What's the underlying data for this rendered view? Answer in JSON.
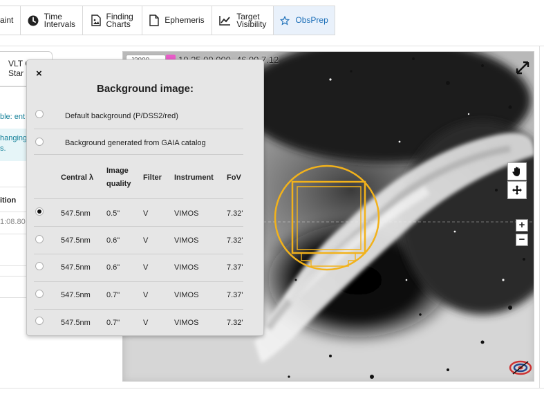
{
  "tabs": [
    {
      "label": "aint",
      "icon": "none",
      "active": false
    },
    {
      "label": "Time\nIntervals",
      "icon": "clock-icon",
      "active": false
    },
    {
      "label": "Finding\nCharts",
      "icon": "image-file-icon",
      "active": false
    },
    {
      "label": "Ephemeris",
      "icon": "file-icon",
      "active": false
    },
    {
      "label": "Target\nVisibility",
      "icon": "line-chart-icon",
      "active": false
    },
    {
      "label": "ObsPrep",
      "icon": "star-icon",
      "active": true
    }
  ],
  "left_pane": {
    "chip_label": "VLT C\nStar",
    "hint_line1": "ble: ent",
    "hint_line2": "hanging\ns.",
    "position_label": "ition",
    "position_value": "1:08.80"
  },
  "aladin": {
    "coord_input": "J2000",
    "coordinates": "10 25 00.000 -46 00 7.12",
    "zoom_in": "+",
    "zoom_out": "−",
    "accent_color": "#f2b21b"
  },
  "bg_popup": {
    "close_label": "×",
    "title": "Background image:",
    "options": [
      {
        "label": "Default background (P/DSS2/red)",
        "checked": false
      },
      {
        "label": "Background generated from GAIA catalog",
        "checked": false
      }
    ],
    "columns": [
      "Central λ",
      "Image\nquality",
      "Filter",
      "Instrument",
      "FoV"
    ],
    "rows": [
      {
        "checked": true,
        "lambda": "547.5nm",
        "quality": "0.5\"",
        "filter": "V",
        "instrument": "VIMOS",
        "fov": "7.32'"
      },
      {
        "checked": false,
        "lambda": "547.5nm",
        "quality": "0.6\"",
        "filter": "V",
        "instrument": "VIMOS",
        "fov": "7.32'"
      },
      {
        "checked": false,
        "lambda": "547.5nm",
        "quality": "0.6\"",
        "filter": "V",
        "instrument": "VIMOS",
        "fov": "7.37'"
      },
      {
        "checked": false,
        "lambda": "547.5nm",
        "quality": "0.7\"",
        "filter": "V",
        "instrument": "VIMOS",
        "fov": "7.37'"
      },
      {
        "checked": false,
        "lambda": "547.5nm",
        "quality": "0.7\"",
        "filter": "V",
        "instrument": "VIMOS",
        "fov": "7.32'"
      }
    ]
  }
}
